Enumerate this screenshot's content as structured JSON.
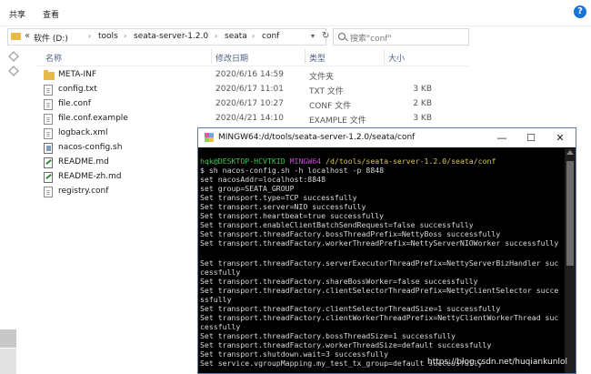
{
  "explorer": {
    "ribbon": {
      "share": "共享",
      "view": "查看"
    },
    "address": {
      "chevron": "«",
      "crumbs": [
        "软件 (D:)",
        "tools",
        "seata-server-1.2.0",
        "seata",
        "conf"
      ],
      "sep": "›"
    },
    "search": {
      "placeholder": "搜索\"conf\""
    },
    "columns": {
      "name": "名称",
      "date": "修改日期",
      "type": "类型",
      "size": "大小"
    },
    "files": [
      {
        "name": "META-INF",
        "date": "2020/6/16 14:59",
        "type": "文件夹",
        "size": "",
        "icon": "folder-icon"
      },
      {
        "name": "config.txt",
        "date": "2020/6/17 11:01",
        "type": "TXT 文件",
        "size": "3 KB",
        "icon": "text-file-icon"
      },
      {
        "name": "file.conf",
        "date": "2020/6/17 10:27",
        "type": "CONF 文件",
        "size": "2 KB",
        "icon": "text-file-icon"
      },
      {
        "name": "file.conf.example",
        "date": "2020/4/21 14:10",
        "type": "EXAMPLE 文件",
        "size": "3 KB",
        "icon": "text-file-icon"
      },
      {
        "name": "logback.xml",
        "date": "",
        "type": "",
        "size": "",
        "icon": "text-file-icon"
      },
      {
        "name": "nacos-config.sh",
        "date": "",
        "type": "",
        "size": "",
        "icon": "script-file-icon"
      },
      {
        "name": "README.md",
        "date": "",
        "type": "",
        "size": "",
        "icon": "markdown-file-icon"
      },
      {
        "name": "README-zh.md",
        "date": "",
        "type": "",
        "size": "",
        "icon": "markdown-file-icon"
      },
      {
        "name": "registry.conf",
        "date": "",
        "type": "",
        "size": "",
        "icon": "text-file-icon"
      }
    ]
  },
  "terminal": {
    "title": "MINGW64:/d/tools/seata-server-1.2.0/seata/conf",
    "controls": {
      "minimize": "—",
      "maximize": "☐",
      "close": "✕"
    },
    "prompt": {
      "user": "hqk@DESKTOP-HCVTKID",
      "shell": "MINGW64",
      "path": "/d/tools/seata-server-1.2.0/seata/conf"
    },
    "lines": [
      "$ sh nacos-config.sh -h localhost -p 8848",
      "set nacosAddr=localhost:8848",
      "set group=SEATA_GROUP",
      "Set transport.type=TCP successfully",
      "Set transport.server=NIO successfully",
      "Set transport.heartbeat=true successfully",
      "Set transport.enableClientBatchSendRequest=false successfully",
      "Set transport.threadFactory.bossThreadPrefix=NettyBoss successfully",
      "Set transport.threadFactory.workerThreadPrefix=NettyServerNIOWorker successfully",
      "",
      "Set transport.threadFactory.serverExecutorThreadPrefix=NettyServerBizHandler suc",
      "cessfully",
      "Set transport.threadFactory.shareBossWorker=false successfully",
      "Set transport.threadFactory.clientSelectorThreadPrefix=NettyClientSelector succe",
      "ssfully",
      "Set transport.threadFactory.clientSelectorThreadSize=1 successfully",
      "Set transport.threadFactory.clientWorkerThreadPrefix=NettyClientWorkerThread suc",
      "cessfully",
      "Set transport.threadFactory.bossThreadSize=1 successfully",
      "Set transport.threadFactory.workerThreadSize=default successfully",
      "Set transport.shutdown.wait=3 successfully",
      "Set service.vgroupMapping.my_test_tx_group=default successfully"
    ]
  },
  "watermark": "https://blog.csdn.net/huqiankunlol"
}
